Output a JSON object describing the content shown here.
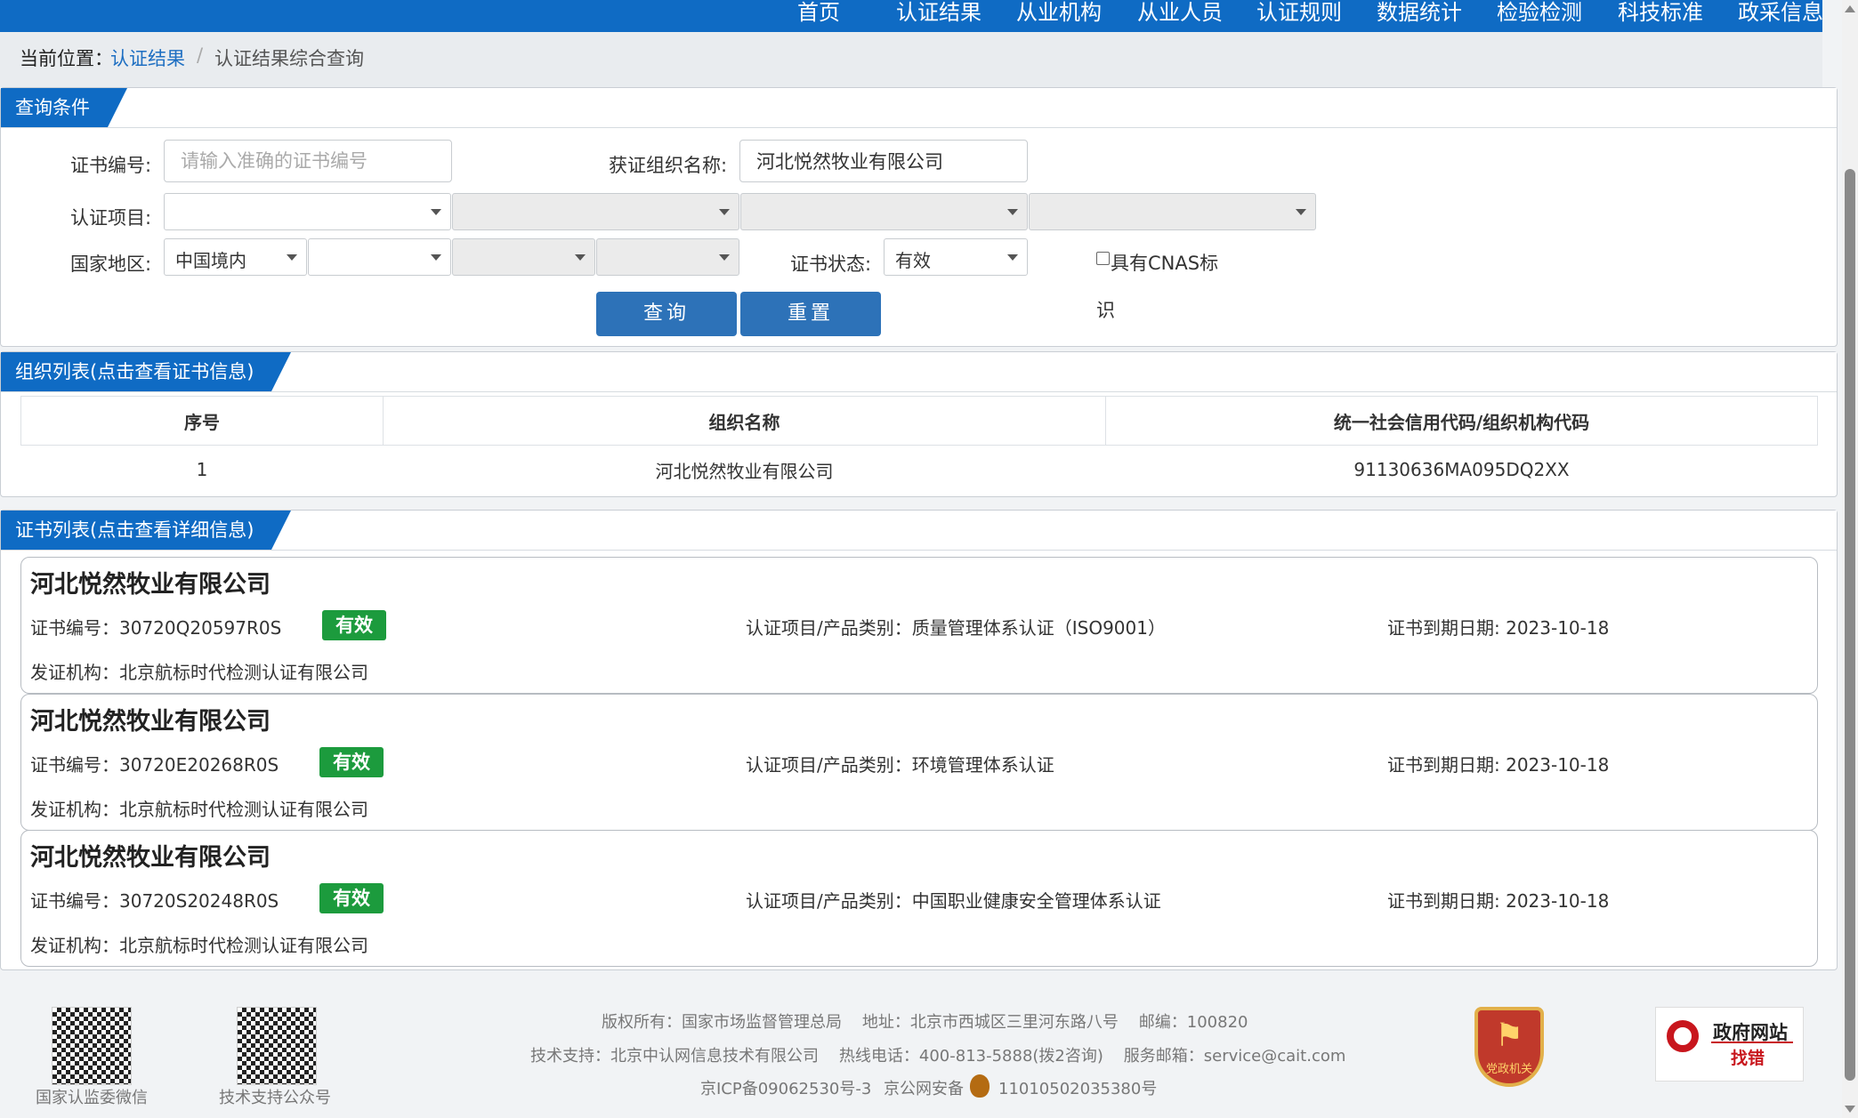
{
  "nav": {
    "items": [
      "首页",
      "认证结果",
      "从业机构",
      "从业人员",
      "认证规则",
      "数据统计",
      "检验检测",
      "科技标准",
      "政采信息"
    ]
  },
  "breadcrumb": {
    "prefix": "当前位置：",
    "link": "认证结果",
    "separator": "/",
    "current": "认证结果综合查询"
  },
  "query": {
    "title": "查询条件",
    "cert_no_label": "证书编号:",
    "cert_no_placeholder": "请输入准确的证书编号",
    "org_label": "获证组织名称:",
    "org_value": "河北悦然牧业有限公司",
    "project_label": "认证项目:",
    "region_label": "国家地区:",
    "region_value": "中国境内",
    "status_label": "证书状态:",
    "status_value": "有效",
    "cnas_label_1": "具有CNAS标",
    "cnas_label_2": "识",
    "search_button": "查询",
    "reset_button": "重置"
  },
  "org_list": {
    "title": "组织列表(点击查看证书信息)",
    "columns": [
      "序号",
      "组织名称",
      "统一社会信用代码/组织机构代码"
    ],
    "rows": [
      [
        "1",
        "河北悦然牧业有限公司",
        "91130636MA095DQ2XX"
      ]
    ]
  },
  "cert_list": {
    "title": "证书列表(点击查看详细信息)",
    "no_prefix": "证书编号：",
    "project_prefix": "认证项目/产品类别：",
    "expiry_prefix": "证书到期日期: ",
    "issuer_prefix": "发证机构：",
    "items": [
      {
        "org": "河北悦然牧业有限公司",
        "no": "证书编号：30720Q20597R0S",
        "status": "有效",
        "project": "认证项目/产品类别：质量管理体系认证（ISO9001）",
        "expiry": "证书到期日期: 2023-10-18",
        "issuer": "发证机构：北京航标时代检测认证有限公司"
      },
      {
        "org": "河北悦然牧业有限公司",
        "no": "证书编号：30720E20268R0S",
        "status": "有效",
        "project": "认证项目/产品类别：环境管理体系认证",
        "expiry": "证书到期日期: 2023-10-18",
        "issuer": "发证机构：北京航标时代检测认证有限公司"
      },
      {
        "org": "河北悦然牧业有限公司",
        "no": "证书编号：30720S20248R0S",
        "status": "有效",
        "project": "认证项目/产品类别：中国职业健康安全管理体系认证",
        "expiry": "证书到期日期: 2023-10-18",
        "issuer": "发证机构：北京航标时代检测认证有限公司"
      }
    ]
  },
  "footer": {
    "qr1_label": "国家认监委微信",
    "qr2_label": "技术支持公众号",
    "line1": "版权所有：国家市场监督管理总局    地址：北京市西城区三里河东路八号    邮编：100820",
    "line2": "技术支持：北京中认网信息技术有限公司    热线电话：400-813-5888(拨2咨询)    服务邮箱：service@cait.com",
    "icp": "京ICP备09062530号-3",
    "police_prefix": "京公网安备",
    "police_no": "11010502035380号",
    "emblem_text": "党政机关",
    "jiucuo_line1": "政府网站",
    "jiucuo_line2": "找错"
  },
  "colors": {
    "primary": "#0f6bc4",
    "button": "#2d72b8",
    "valid_badge": "#1c9b3d",
    "link": "#1e6fc2"
  }
}
